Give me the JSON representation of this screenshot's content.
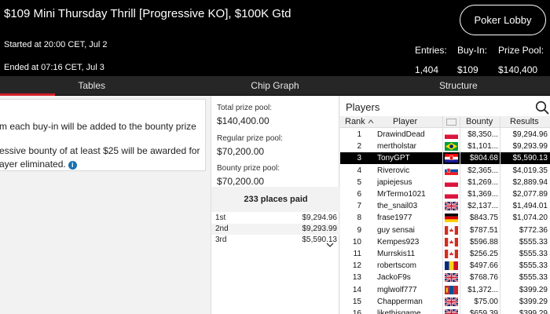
{
  "header": {
    "title": "$109 Mini Thursday Thrill [Progressive KO], $100K Gtd",
    "started": "Started at 20:00 CET, Jul 2",
    "ended": "Ended at 07:16 CET, Jul 3",
    "lobby_button": "Poker Lobby",
    "entries_label": "Entries:",
    "entries_value": "1,404",
    "buyin_label": "Buy-In:",
    "buyin_value": "$109",
    "prize_label": "Prize Pool:",
    "prize_value": "$140,400"
  },
  "tabs": [
    "Tables",
    "Chip Graph",
    "Structure"
  ],
  "info": {
    "line1": "m each buy-in will be added to the bounty prize",
    "line2": "essive bounty of at least $25 will be awarded for",
    "line3": "ayer eliminated.",
    "info_icon": "i"
  },
  "prizes": {
    "total_label": "Total prize pool:",
    "total_value": "$140,400.00",
    "regular_label": "Regular prize pool:",
    "regular_value": "$70,200.00",
    "bounty_label": "Bounty prize pool:",
    "bounty_value": "$70,200.00",
    "places_paid": "233 places paid",
    "places": [
      {
        "rank": "1st",
        "amount": "$9,294.96"
      },
      {
        "rank": "2nd",
        "amount": "$9,293.99"
      },
      {
        "rank": "3rd",
        "amount": "$5,590.13"
      }
    ],
    "expand_icon": "chevron-down-icon"
  },
  "players": {
    "title": "Players",
    "search_icon": "search-icon",
    "columns": {
      "rank": "Rank",
      "player": "Player",
      "bounty": "Bounty",
      "results": "Results"
    },
    "rows": [
      {
        "rank": "1",
        "name": "DrawindDead",
        "flag": "poland",
        "bounty": "$8,350...",
        "result": "$9,294.96"
      },
      {
        "rank": "2",
        "name": "mertholstar",
        "flag": "brazil",
        "bounty": "$1,101...",
        "result": "$9,293.99"
      },
      {
        "rank": "3",
        "name": "TonyGPT",
        "flag": "croatia",
        "bounty": "$804.68",
        "result": "$5,590.13",
        "selected": true
      },
      {
        "rank": "4",
        "name": "Riverovic",
        "flag": "slovakia",
        "bounty": "$2,365...",
        "result": "$4,019.35"
      },
      {
        "rank": "5",
        "name": "japiejesus",
        "flag": "poland",
        "bounty": "$1,269...",
        "result": "$2,889.94"
      },
      {
        "rank": "6",
        "name": "MrTermo1021",
        "flag": "poland",
        "bounty": "$1,369...",
        "result": "$2,077.89"
      },
      {
        "rank": "7",
        "name": "the_snail03",
        "flag": "uk",
        "bounty": "$2,137...",
        "result": "$1,494.01"
      },
      {
        "rank": "8",
        "name": "frase1977",
        "flag": "germany",
        "bounty": "$843.75",
        "result": "$1,074.20"
      },
      {
        "rank": "9",
        "name": "guy sensai",
        "flag": "canada",
        "bounty": "$787.51",
        "result": "$772.36"
      },
      {
        "rank": "10",
        "name": "Kempes923",
        "flag": "canada",
        "bounty": "$596.88",
        "result": "$555.33"
      },
      {
        "rank": "11",
        "name": "Murrskis11",
        "flag": "canada",
        "bounty": "$256.25",
        "result": "$555.33"
      },
      {
        "rank": "12",
        "name": "robertscom",
        "flag": "romania",
        "bounty": "$497.66",
        "result": "$555.33"
      },
      {
        "rank": "13",
        "name": "JackoF9s",
        "flag": "uk",
        "bounty": "$768.76",
        "result": "$555.33"
      },
      {
        "rank": "14",
        "name": "mglwolf777",
        "flag": "mongolia",
        "bounty": "$1,372...",
        "result": "$399.29"
      },
      {
        "rank": "15",
        "name": "Chapperman",
        "flag": "uk",
        "bounty": "$75.00",
        "result": "$399.29"
      },
      {
        "rank": "16",
        "name": "likethisgame",
        "flag": "uk",
        "bounty": "$659.39",
        "result": "$399.29"
      }
    ]
  }
}
